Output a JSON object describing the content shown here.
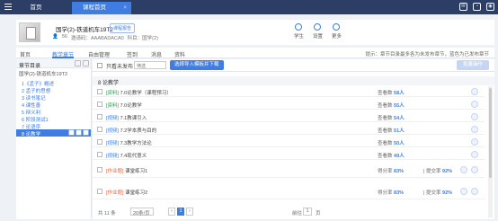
{
  "topbar": {
    "tabs": [
      {
        "label": "首页"
      },
      {
        "label": "课程首页",
        "close": "×"
      }
    ],
    "icons": [
      "message-icon",
      "notification-icon",
      "user-icon"
    ]
  },
  "course": {
    "title": "国学(2)-铁道机车19T2",
    "badge": "课程报告",
    "meta": [
      "56",
      "邀请码：AAABADACA0",
      "科目：国学(2)"
    ],
    "actions": [
      {
        "label": "学生",
        "icon": "student-icon"
      },
      {
        "label": "设置",
        "icon": "settings-icon"
      },
      {
        "label": "更多",
        "icon": "more-icon"
      }
    ]
  },
  "nav": {
    "items": [
      "首页",
      "教学章节",
      "自由管理",
      "签到",
      "消息",
      "资料"
    ],
    "active": "教学章节",
    "tip": "提示：章节目录最多各为未发布章节，蓝色为已发布章节"
  },
  "chapters": {
    "header": "章节目录",
    "root": "国学(2)-铁道机车19T2",
    "items": [
      {
        "label": "1《孟子》概述"
      },
      {
        "label": "2 孟子的思想"
      },
      {
        "label": "3 读书笔记"
      },
      {
        "label": "4 课性善"
      },
      {
        "label": "5 辩义利"
      },
      {
        "label": "6 阶段测试1"
      },
      {
        "label": "7 论语序"
      },
      {
        "label": "8 论教学",
        "selected": true
      }
    ]
  },
  "toolbar": {
    "filter_label": "只看未发布",
    "filter_value": "筛选",
    "import_button": "选择导入模板并下载",
    "right_button": "批量操作"
  },
  "section": {
    "title": "8 论教学",
    "rows": [
      {
        "tag": "[资料]",
        "name": "7.0论教学（课程预习）",
        "stat_label": "查看数",
        "stat_value": "58人",
        "kind": "doc"
      },
      {
        "tag": "[资料]",
        "name": "7.0论教学",
        "stat_label": "查看数",
        "stat_value": "55人",
        "kind": "doc"
      },
      {
        "tag": "[视频]",
        "name": "7.1教课引入",
        "stat_label": "查看数",
        "stat_value": "54人",
        "kind": "video"
      },
      {
        "tag": "[视频]",
        "name": "7.2学本质与目的",
        "stat_label": "查看数",
        "stat_value": "51人",
        "kind": "video"
      },
      {
        "tag": "[视频]",
        "name": "7.3教学方法论",
        "stat_label": "查看数",
        "stat_value": "50人",
        "kind": "video"
      },
      {
        "tag": "[视频]",
        "name": "7.4现代意义",
        "stat_label": "查看数",
        "stat_value": "49人",
        "kind": "video"
      },
      {
        "tag": "[作业题]",
        "name": "课堂练习1",
        "stat_label": "得分率",
        "stat_value": "83%",
        "stat2_label": "提交率",
        "stat2_value": "92%",
        "kind": "task"
      },
      {
        "tag": "[作业题]",
        "name": "课堂练习2",
        "stat_label": "得分率",
        "stat_value": "83%",
        "stat2_label": "提交率",
        "stat2_value": "92%",
        "kind": "task"
      }
    ]
  },
  "pager": {
    "total": "共 11 条",
    "page_size": "20条/页",
    "prev": "‹",
    "current": "1",
    "next": "›",
    "goto_label": "前往",
    "goto_value": "1",
    "page_unit": "页"
  }
}
